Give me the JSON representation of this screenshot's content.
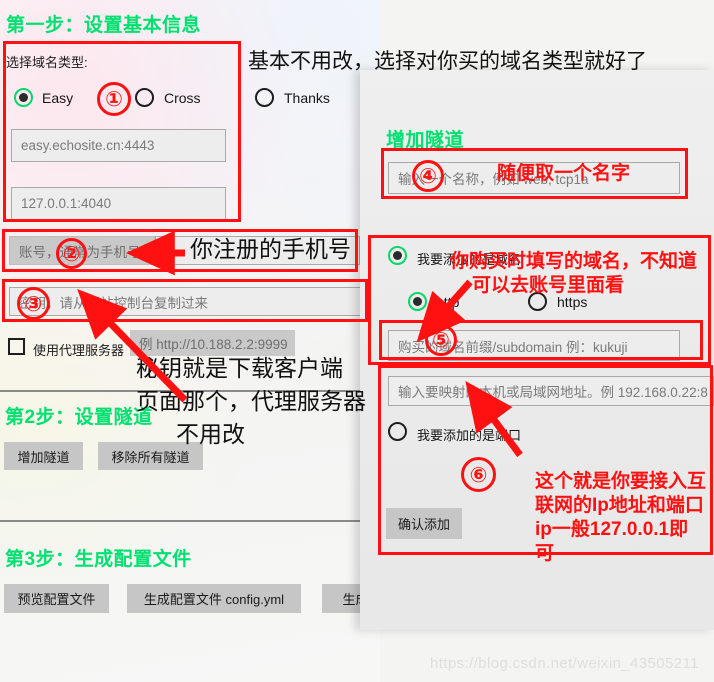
{
  "left_panel": {
    "step1_heading": "第一步：设置基本信息",
    "domain_type_label": "选择域名类型:",
    "radio_easy": "Easy",
    "radio_cross": "Cross",
    "radio_thanks": "Thanks",
    "server_addr_value": "easy.echosite.cn:4443",
    "local_addr_value": "127.0.0.1:4040",
    "account_placeholder": "账号，通常为手机号",
    "secret_placeholder": "密钥，请从网站控制台复制过来",
    "proxy_checkbox_label": "使用代理服务器",
    "proxy_placeholder": "例 http://10.188.2.2:9999",
    "step2_heading": "第2步：设置隧道",
    "btn_add_tunnel": "增加隧道",
    "btn_remove_all_tunnels": "移除所有隧道",
    "step3_heading": "第3步：生成配置文件",
    "btn_preview_config": "预览配置文件",
    "btn_generate_config": "生成配置文件 config.yml",
    "btn_generate_more": "生成批"
  },
  "dialog": {
    "heading": "增加隧道",
    "name_placeholder": "输入一个名称，例如 web, tcp1a",
    "radio_domain": "我要添加的是域名",
    "radio_http": "http",
    "radio_https": "https",
    "subdomain_placeholder": "购买的域名前缀/subdomain 例：kukuji",
    "target_placeholder": "输入要映射的本机或局域网地址。例 192.168.0.22:8",
    "radio_port": "我要添加的是端口",
    "btn_confirm_add": "确认添加"
  },
  "annotations": {
    "note_top": "基本不用改，选择对你买的域名类型就好了",
    "note_phone": "你注册的手机号",
    "note_secret_l1": "秘钥就是下载客户端",
    "note_secret_l2": "页面那个，代理服务器",
    "note_secret_l3": "不用改",
    "note_name": "随便取一个名字",
    "note_domain_l1": "你购买时填写的域名，不知道",
    "note_domain_l2": "可以去账号里面看",
    "note_ip_l1": "这个就是你要接入互",
    "note_ip_l2": "联网的Ip地址和端口",
    "note_ip_l3": "ip一般127.0.0.1即",
    "note_ip_l4": "可",
    "marker_1": "①",
    "marker_2": "②",
    "marker_3": "③",
    "marker_4": "④",
    "marker_5": "⑤",
    "marker_6": "⑥"
  },
  "watermark": "https://blog.csdn.net/weixin_43505211",
  "colors": {
    "heading_green": "#00e070",
    "annotation_red": "#ff1111",
    "radio_active_green": "#06d86a"
  }
}
